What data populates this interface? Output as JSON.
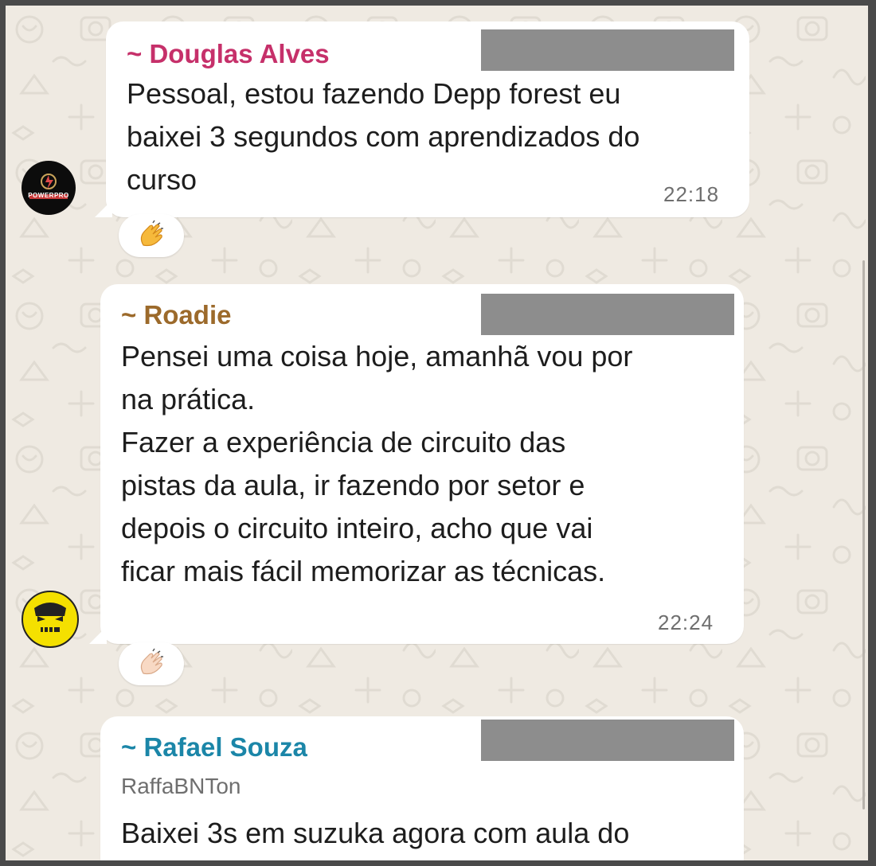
{
  "colors": {
    "chat_background": "#efeae2",
    "bubble": "#ffffff",
    "sender_douglas": "#c6306a",
    "sender_roadie": "#9c6a2b",
    "sender_rafael": "#1b86a8",
    "redaction": "#8d8d8d",
    "timestamp": "#6f6f6f"
  },
  "messages": [
    {
      "sender": "~ Douglas Alves",
      "avatar": "powerpro-logo-avatar",
      "avatar_text": "POWERPRO",
      "lines": [
        "Pessoal, estou fazendo Depp forest eu",
        "baixei 3 segundos com aprendizados do",
        "curso"
      ],
      "time": "22:18",
      "reaction": "clapping-hands-emoji"
    },
    {
      "sender": "~ Roadie",
      "avatar": "yellow-skull-avatar",
      "lines": [
        "Pensei uma coisa hoje, amanhã vou por",
        "na prática.",
        "Fazer a experiência de circuito das",
        "pistas da aula, ir fazendo por setor e",
        "depois o circuito inteiro, acho que vai",
        "ficar mais fácil memorizar as técnicas."
      ],
      "time": "22:24",
      "reaction": "clapping-hands-light-emoji"
    },
    {
      "sender": "~ Rafael Souza",
      "handle": "RaffaBNTon",
      "lines": [
        "Baixei 3s em suzuka agora com aula do"
      ]
    }
  ]
}
